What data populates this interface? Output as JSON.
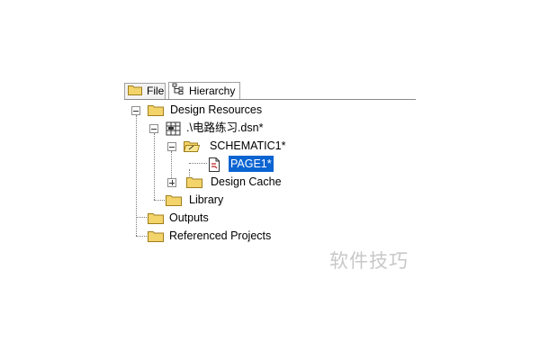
{
  "tabs": [
    {
      "label": "File",
      "icon": "folder-icon",
      "active": false
    },
    {
      "label": "Hierarchy",
      "icon": "hierarchy-icon",
      "active": true
    }
  ],
  "tree": {
    "design_resources": "Design Resources",
    "dsn_file": ".\\电路练习.dsn*",
    "schematic": "SCHEMATIC1*",
    "page": "PAGE1*",
    "design_cache": "Design Cache",
    "library": "Library",
    "outputs": "Outputs",
    "referenced_projects": "Referenced Projects"
  },
  "watermark": "软件技巧",
  "colors": {
    "selection": "#0a64d2",
    "folder_fill": "#f3d46a",
    "folder_stroke": "#a07d1c"
  }
}
